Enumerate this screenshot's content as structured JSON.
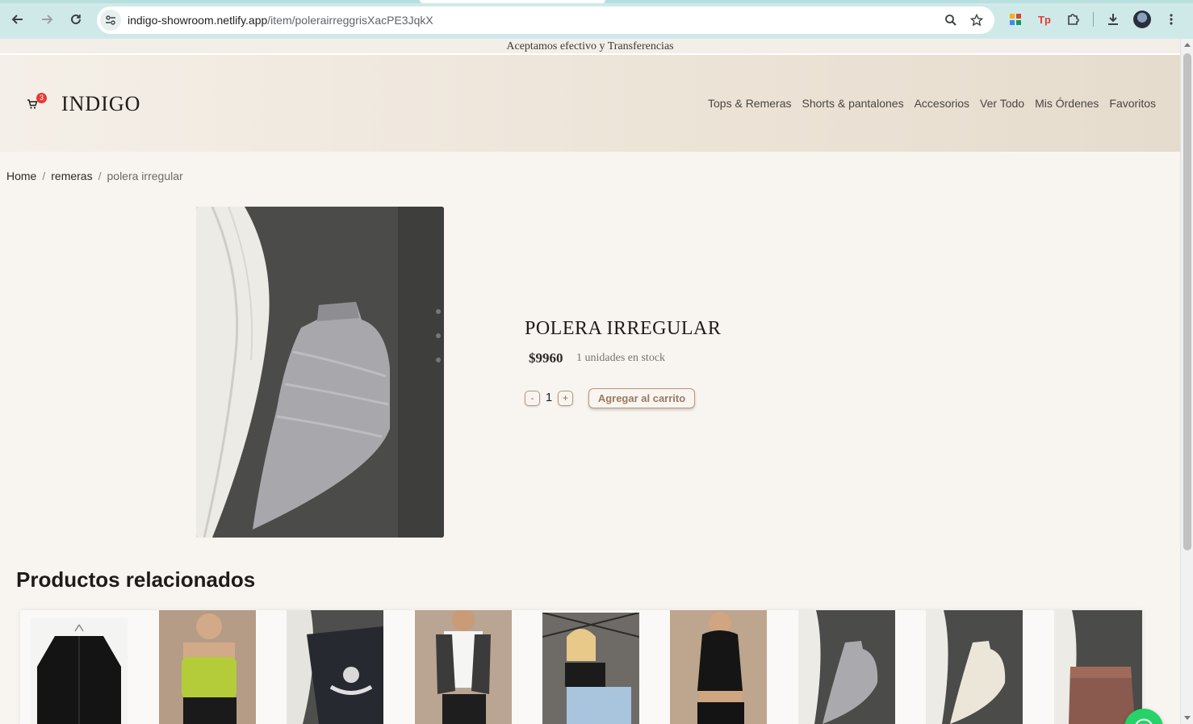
{
  "browser": {
    "url_host": "indigo-showroom.netlify.app",
    "url_path": "/item/polerairreggrisXacPE3JqkX",
    "icons": [
      "back-icon",
      "forward-icon",
      "reload-icon",
      "site-settings-icon",
      "zoom-icon",
      "star-icon",
      "extension-icon",
      "tp-icon",
      "puzzle-icon",
      "download-icon",
      "profile-avatar",
      "menu-icon"
    ]
  },
  "banner": {
    "text": "Aceptamos efectivo y Transferencias"
  },
  "header": {
    "brand": "INDIGO",
    "cart_count": "3",
    "nav": [
      "Tops & Remeras",
      "Shorts & pantalones",
      "Accesorios",
      "Ver Todo",
      "Mis Órdenes",
      "Favoritos"
    ]
  },
  "breadcrumb": {
    "home": "Home",
    "category": "remeras",
    "current": "polera irregular",
    "separator": "/"
  },
  "product": {
    "title": "POLERA IRREGULAR",
    "price": "$9960",
    "stock": "1 unidades en stock",
    "quantity": "1",
    "minus_label": "-",
    "plus_label": "+",
    "add_label": "Agregar al carrito"
  },
  "related": {
    "title": "Productos relacionados",
    "count": 9
  },
  "colors": {
    "accent": "#b7977c",
    "badge": "#e53935",
    "whatsapp": "#25d366",
    "chrome": "#cfe9e9"
  }
}
